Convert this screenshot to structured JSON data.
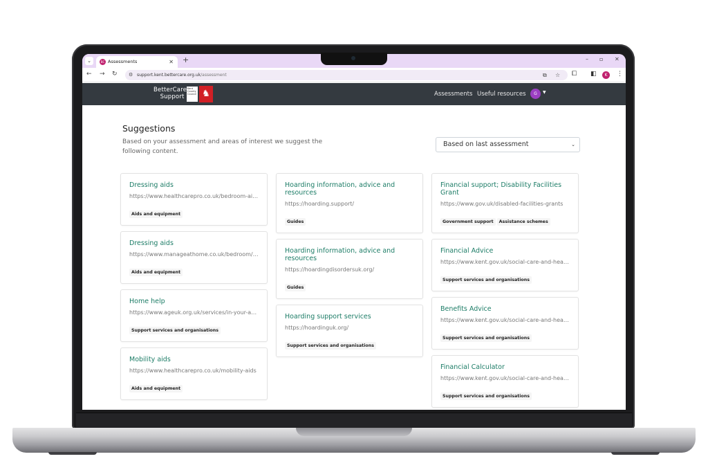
{
  "browser": {
    "tab_title": "Assessments",
    "favicon_label": "BC",
    "url_host": "support.kent.bettercare.org.uk",
    "url_path": "/assessment",
    "profile_initial": "K"
  },
  "site": {
    "logo_line1": "BetterCare",
    "logo_line2": "Support",
    "kent_badge": "Kent County Council",
    "nav": [
      "Assessments",
      "Useful resources"
    ],
    "user_initial": "G"
  },
  "page": {
    "title": "Suggestions",
    "description": "Based on your assessment and areas of interest we suggest the following content.",
    "filter_value": "Based on last assessment"
  },
  "columns": [
    [
      {
        "title": "Dressing aids",
        "url": "https://www.healthcarepro.co.uk/bedroom-aids/dressing-aids",
        "tags": [
          "Aids and equipment"
        ]
      },
      {
        "title": "Dressing aids",
        "url": "https://www.manageathome.co.uk/bedroom/dressing-aids",
        "tags": [
          "Aids and equipment"
        ]
      },
      {
        "title": "Home help",
        "url": "https://www.ageuk.org.uk/services/in-your-area/home-help",
        "tags": [
          "Support services and organisations"
        ]
      },
      {
        "title": "Mobility aids",
        "url": "https://www.healthcarepro.co.uk/mobility-aids",
        "tags": [
          "Aids and equipment"
        ]
      }
    ],
    [
      {
        "title": "Hoarding information, advice and resources",
        "url": "https://hoarding.support/",
        "tags": [
          "Guides"
        ]
      },
      {
        "title": "Hoarding information, advice and resources",
        "url": "https://hoardingdisordersuk.org/",
        "tags": [
          "Guides"
        ]
      },
      {
        "title": "Hoarding support services",
        "url": "https://hoardinguk.org/",
        "tags": [
          "Support services and organisations"
        ]
      }
    ],
    [
      {
        "title": "Financial support; Disability Facilities Grant",
        "url": "https://www.gov.uk/disabled-facilities-grants",
        "tags": [
          "Government support",
          "Assistance schemes"
        ]
      },
      {
        "title": "Financial Advice",
        "url": "https://www.kent.gov.uk/social-care-and-health",
        "tags": [
          "Support services and organisations"
        ]
      },
      {
        "title": "Benefits Advice",
        "url": "https://www.kent.gov.uk/social-care-and-health",
        "tags": [
          "Support services and organisations"
        ]
      },
      {
        "title": "Financial Calculator",
        "url": "https://www.kent.gov.uk/social-care-and-health",
        "tags": [
          "Support services and organisations"
        ]
      }
    ]
  ]
}
